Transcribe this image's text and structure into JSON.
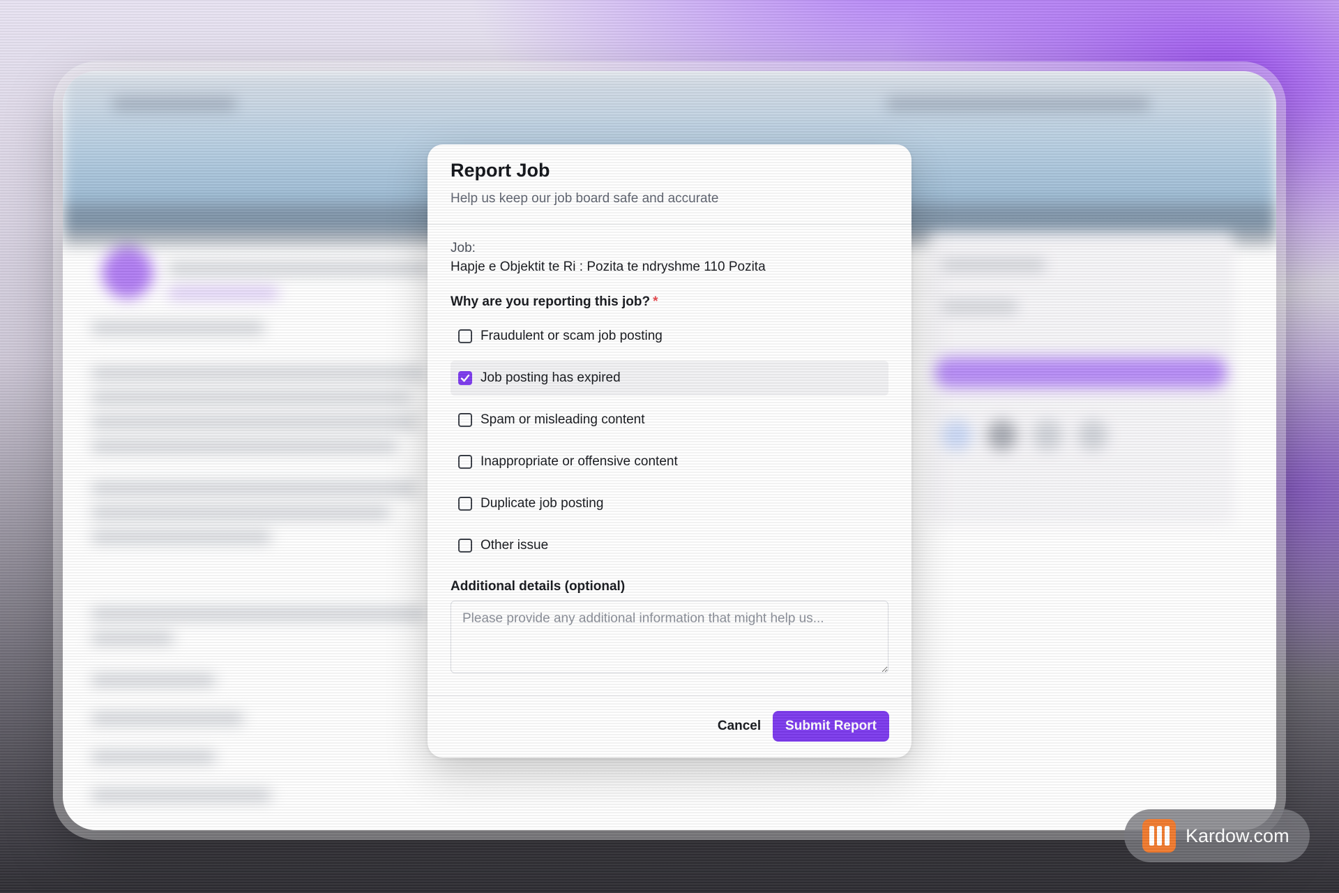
{
  "modal": {
    "title": "Report Job",
    "subtitle": "Help us keep our job board safe and accurate",
    "job_label": "Job:",
    "job_title": "Hapje e Objektit te Ri : Pozita te ndryshme 110 Pozita",
    "question": "Why are you reporting this job?",
    "required_mark": "*",
    "options": [
      {
        "label": "Fraudulent or scam job posting",
        "checked": false
      },
      {
        "label": "Job posting has expired",
        "checked": true
      },
      {
        "label": "Spam or misleading content",
        "checked": false
      },
      {
        "label": "Inappropriate or offensive content",
        "checked": false
      },
      {
        "label": "Duplicate job posting",
        "checked": false
      },
      {
        "label": "Other issue",
        "checked": false
      }
    ],
    "details_label": "Additional details (optional)",
    "details_placeholder": "Please provide any additional information that might help us...",
    "details_value": "",
    "cancel_label": "Cancel",
    "submit_label": "Submit Report"
  },
  "colors": {
    "accent": "#7c3aed",
    "required": "#e5484d"
  },
  "watermark": {
    "text": "Kardow.com"
  }
}
